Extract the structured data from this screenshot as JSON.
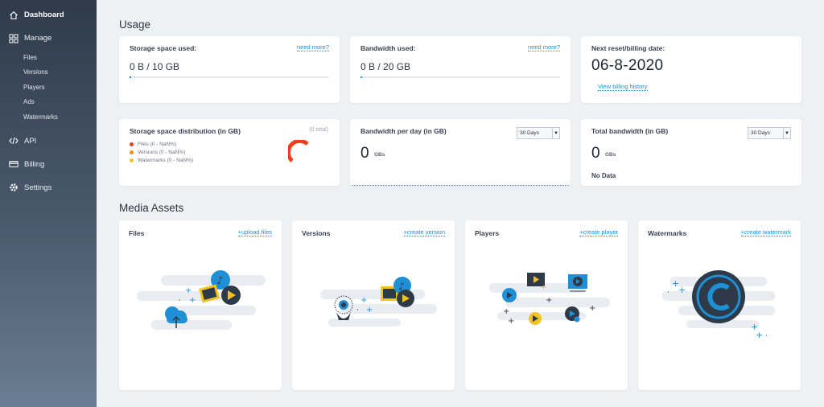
{
  "sidebar": {
    "dashboard": "Dashboard",
    "manage": "Manage",
    "manage_items": [
      "Files",
      "Versions",
      "Players",
      "Ads",
      "Watermarks"
    ],
    "api": "API",
    "billing": "Billing",
    "settings": "Settings"
  },
  "usage": {
    "title": "Usage",
    "storage": {
      "label": "Storage space used:",
      "link": "need more?",
      "value": "0 B / 10 GB",
      "progress": 0
    },
    "bandwidth": {
      "label": "Bandwidth used:",
      "link": "need more?",
      "value": "0 B / 20 GB",
      "progress": 0
    },
    "billing": {
      "label": "Next reset/billing date:",
      "date": "06-8-2020",
      "link": "View billing history"
    },
    "distribution": {
      "label": "Storage space distribution (in GB)",
      "total": "(0 total)",
      "legend": [
        {
          "text": "Files (0 - NaN%)",
          "color": "#e8401c"
        },
        {
          "text": "Versions (0 - NaN%)",
          "color": "#f28c1e"
        },
        {
          "text": "Watermarks (0 - NaN%)",
          "color": "#f2c21e"
        }
      ]
    },
    "bw_per_day": {
      "label": "Bandwidth per day (in GB)",
      "select": "30 Days",
      "value": "0",
      "unit": "GBs"
    },
    "total_bw": {
      "label": "Total bandwidth (in GB)",
      "select": "30 Days",
      "value": "0",
      "unit": "GBs",
      "nodata": "No Data"
    }
  },
  "assets": {
    "title": "Media Assets",
    "cards": [
      {
        "title": "Files",
        "link": "+upload files"
      },
      {
        "title": "Versions",
        "link": "+create version"
      },
      {
        "title": "Players",
        "link": "+create player"
      },
      {
        "title": "Watermarks",
        "link": "+create watermark"
      }
    ]
  },
  "colors": {
    "accent": "#1f8fd6",
    "dark": "#2e3a48",
    "yellow": "#f2c21e"
  }
}
